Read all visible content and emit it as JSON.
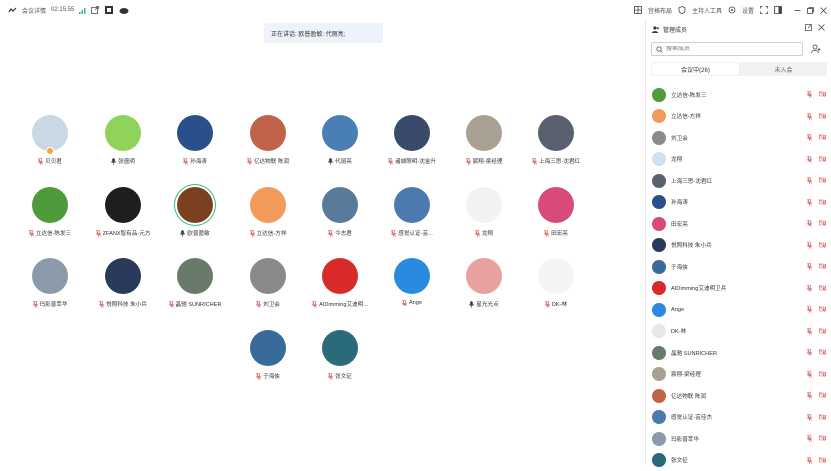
{
  "topbar": {
    "meeting_details_label": "会议详情",
    "timer": "02:15:55",
    "layout_label": "宫格布局",
    "host_label": "主持人工具",
    "settings_label": "设置"
  },
  "banner": {
    "speaking_text": "正在讲话: 欧普盈敏: 代丽亮;"
  },
  "tiles": [
    {
      "name": "贝贝君",
      "muted": true,
      "color": "#c9d8e4",
      "host": true
    },
    {
      "name": "张盛明",
      "muted": false,
      "color": "#8fd35a"
    },
    {
      "name": "孙海涛",
      "muted": true,
      "color": "#2b4f8a"
    },
    {
      "name": "亿达物联 陈润",
      "muted": true,
      "color": "#c0634a"
    },
    {
      "name": "代丽亮",
      "muted": false,
      "color": "#4a7fb5"
    },
    {
      "name": "诸城照明-沈金升",
      "muted": true,
      "color": "#3a4a6a"
    },
    {
      "name": "宸翔-梁经理",
      "muted": true,
      "color": "#a8a090"
    },
    {
      "name": "上海三思-沈君红",
      "muted": true,
      "color": "#5a6070"
    },
    {
      "name": "立达信-陈发三",
      "muted": true,
      "color": "#4f9a3a"
    },
    {
      "name": "ZFANX智有品-元方",
      "muted": true,
      "color": "#1e1e1e"
    },
    {
      "name": "欧普盈敏",
      "muted": false,
      "color": "#7a4020",
      "ring": true
    },
    {
      "name": "立达信-方祥",
      "muted": true,
      "color": "#f29a5a"
    },
    {
      "name": "今志君",
      "muted": true,
      "color": "#5a7a9a"
    },
    {
      "name": "感觉认证-芸...",
      "muted": true,
      "color": "#4a7ab0"
    },
    {
      "name": "龙翔",
      "muted": true,
      "color": "#f2f2f2"
    },
    {
      "name": "田宏亮",
      "muted": true,
      "color": "#d84a7a"
    },
    {
      "name": "玛影普萃华",
      "muted": true,
      "color": "#8a9aaa"
    },
    {
      "name": "悦照科技 朱小兵",
      "muted": true,
      "color": "#2a3a5a"
    },
    {
      "name": "晶驰 SUNRICHER",
      "muted": true,
      "color": "#6a7a6a"
    },
    {
      "name": "刘卫会",
      "muted": true,
      "color": "#8a8a8a"
    },
    {
      "name": "AIDimming艾迪明...",
      "muted": true,
      "color": "#d82a2a"
    },
    {
      "name": "Ange",
      "muted": true,
      "color": "#2a8ae0"
    },
    {
      "name": "星光光点",
      "muted": false,
      "color": "#e8a0a0"
    },
    {
      "name": "DK-林",
      "muted": true,
      "color": "#f4f4f4"
    },
    {
      "name": "于海侠",
      "muted": true,
      "color": "#3a6a9a"
    },
    {
      "name": "张文征",
      "muted": true,
      "color": "#2a6a7a"
    }
  ],
  "sidebar": {
    "title": "管理成员",
    "search_placeholder": "搜索成员",
    "tab_in_meeting": "会议中(26)",
    "tab_not_joined": "未入会",
    "participants": [
      {
        "name": "立达信-陈发三",
        "color": "#4f9a3a"
      },
      {
        "name": "立达信-方祥",
        "color": "#f29a5a"
      },
      {
        "name": "刘卫会",
        "color": "#8a8a8a"
      },
      {
        "name": "龙翔",
        "color": "#cfe0f0"
      },
      {
        "name": "上海三思-沈君红",
        "color": "#5a6070"
      },
      {
        "name": "孙海涛",
        "color": "#2b4f8a"
      },
      {
        "name": "田宏亮",
        "color": "#d84a7a"
      },
      {
        "name": "悦照科技 朱小兵",
        "color": "#2a3a5a"
      },
      {
        "name": "于海侠",
        "color": "#3a6a9a"
      },
      {
        "name": "AIDimming艾迪明卫兵",
        "color": "#d82a2a"
      },
      {
        "name": "Ange",
        "color": "#2a8ae0"
      },
      {
        "name": "DK-林",
        "color": "#e8e8e8"
      },
      {
        "name": "晶驰 SUNRICHER",
        "color": "#6a7a6a"
      },
      {
        "name": "宸翔-梁经理",
        "color": "#a8a090"
      },
      {
        "name": "亿达物联 陈润",
        "color": "#c0634a"
      },
      {
        "name": "感觉认证-芸佳杰",
        "color": "#4a7ab0"
      },
      {
        "name": "玛影普萃华",
        "color": "#8a9aaa"
      },
      {
        "name": "张文征",
        "color": "#2a6a7a"
      }
    ]
  },
  "colors": {
    "accent": "#2a7ae0",
    "muted_red": "#d9534f",
    "ring_green": "#2fbf71"
  }
}
